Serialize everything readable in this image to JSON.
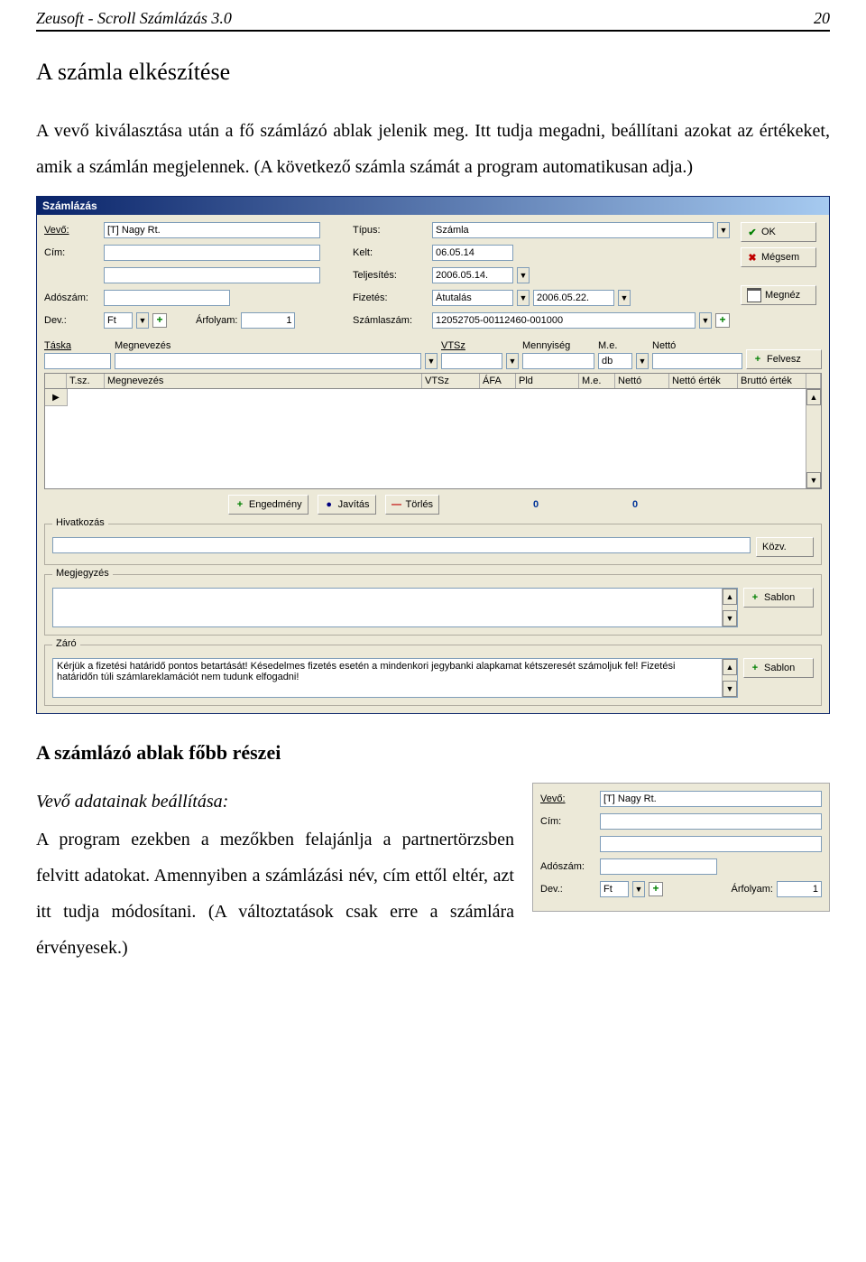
{
  "doc_header_left": "Zeusoft - Scroll Számlázás 3.0",
  "doc_header_right": "20",
  "section_title": "A számla elkészítése",
  "intro_para": "A vevő kiválasztása után a fő számlázó ablak jelenik meg. Itt tudja megadni, beállítani azokat az értékeket, amik a számlán megjelennek. (A következő számla számát a program automatikusan adja.)",
  "outro_h2": "A számlázó ablak főbb részei",
  "outro_h3": "Vevő adatainak beállítása:",
  "outro_para": "A program ezekben a mezőkben felajánlja a partnertörzsben felvitt adatokat. Amennyiben a számlázási név, cím ettől eltér, azt itt tudja módosítani. (A változtatások csak erre a számlára érvényesek.)",
  "app": {
    "title": "Számlázás",
    "labels": {
      "vevo": "Vevő:",
      "cim": "Cím:",
      "adoszam": "Adószám:",
      "dev": "Dev.:",
      "arfolyam": "Árfolyam:",
      "tipus": "Típus:",
      "kelt": "Kelt:",
      "teljesites": "Teljesítés:",
      "fizetes": "Fizetés:",
      "szamlaszam": "Számlaszám:"
    },
    "values": {
      "vevo": "[T] Nagy Rt.",
      "cim1": "",
      "cim2": "",
      "adoszam": "",
      "dev": "Ft",
      "arfolyam": "1",
      "tipus": "Számla",
      "kelt": "06.05.14",
      "teljesites": "2006.05.14.",
      "fizetes": "Átutalás",
      "fizetes_date": "2006.05.22.",
      "szamlaszam": "12052705-00112460-001000"
    },
    "buttons": {
      "ok": "OK",
      "megsem": "Mégsem",
      "megnez": "Megnéz",
      "felvesz": "Felvesz",
      "engedmeny": "Engedmény",
      "javitas": "Javítás",
      "torles": "Törlés",
      "kozv": "Közv.",
      "sablon": "Sablon"
    },
    "item_headers": {
      "taska": "Táska",
      "megnevezes": "Megnevezés",
      "vtsz": "VTSz",
      "mennyiseg": "Mennyiség",
      "me": "M.e.",
      "netto": "Nettó"
    },
    "item_values": {
      "me": "db"
    },
    "grid_cols": {
      "tsz": "T.sz.",
      "megnevezes": "Megnevezés",
      "vtsz": "VTSz",
      "afa": "ÁFA",
      "pld": "Pld",
      "me": "M.e.",
      "netto": "Nettó",
      "netto_ertek": "Nettó érték",
      "brutto_ertek": "Bruttó érték"
    },
    "totals": {
      "a": "0",
      "b": "0"
    },
    "groups": {
      "hivatkozas": "Hivatkozás",
      "megjegyzes": "Megjegyzés",
      "zaro": "Záró"
    },
    "zaro_text": "Kérjük a fizetési határidő pontos betartását! Késedelmes fizetés esetén a mindenkori jegybanki alapkamat kétszeresét számoljuk fel! Fizetési határidőn túli számlareklamációt nem tudunk elfogadni!"
  },
  "snippet": {
    "vevo_label": "Vevő:",
    "vevo_value": "[T] Nagy Rt.",
    "cim_label": "Cím:",
    "adoszam_label": "Adószám:",
    "dev_label": "Dev.:",
    "dev_value": "Ft",
    "arfolyam_label": "Árfolyam:",
    "arfolyam_value": "1"
  }
}
